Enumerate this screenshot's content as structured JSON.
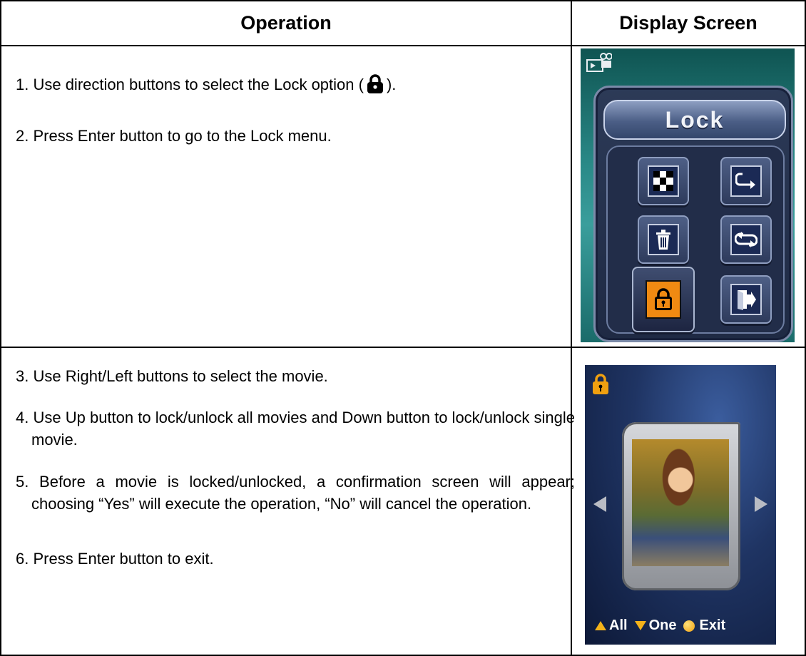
{
  "header": {
    "operation": "Operation",
    "display_screen": "Display Screen"
  },
  "row1": {
    "step1_before": "1. Use direction buttons to select the Lock option (",
    "step1_after": ").",
    "step2": "2. Press Enter button to go to the Lock menu.",
    "screen": {
      "title": "Lock",
      "icons": [
        "slideshow-icon",
        "repeat-one-icon",
        "delete-icon",
        "repeat-all-icon",
        "lock-icon",
        "exit-icon"
      ],
      "selected_icon": "lock-icon"
    }
  },
  "row2": {
    "step3": "3. Use Right/Left buttons to select the movie.",
    "step4": "4. Use Up button to lock/unlock all movies and Down button to lock/unlock single movie.",
    "step5": "5. Before a movie is locked/unlocked, a confirmation screen will appear; choosing “Yes” will execute the operation, “No” will cancel the operation.",
    "step6": "6. Press Enter button to exit.",
    "screen": {
      "legend_all": "All",
      "legend_one": "One",
      "legend_exit": "Exit"
    }
  },
  "colors": {
    "accent_orange": "#f08a12",
    "legend_yellow": "#f3b21a"
  }
}
